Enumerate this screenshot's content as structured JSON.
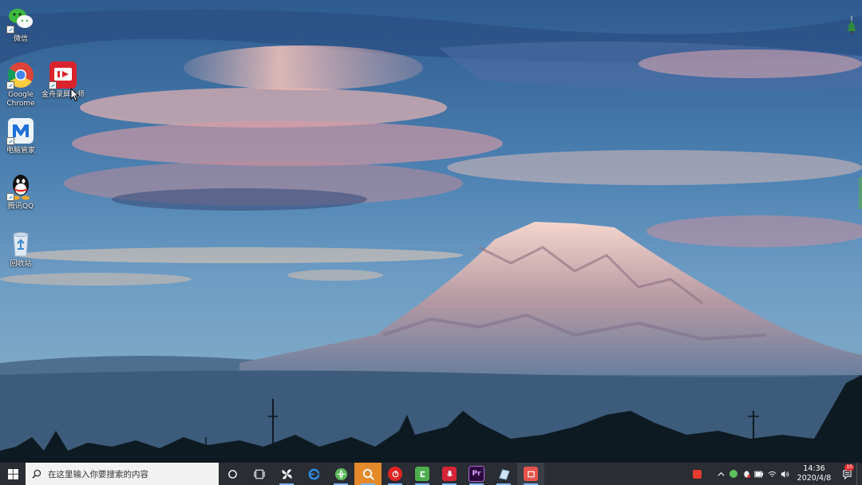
{
  "desktop": {
    "icons": [
      {
        "label": "微信",
        "icon": "wechat-icon"
      },
      {
        "label": "Google Chrome",
        "icon": "chrome-icon"
      },
      {
        "label": "金舟录屏大师",
        "icon": "screen-recorder-icon"
      },
      {
        "label": "电脑管家",
        "icon": "pc-manager-icon"
      },
      {
        "label": "腾讯QQ",
        "icon": "qq-icon"
      },
      {
        "label": "回收站",
        "icon": "recycle-bin-icon"
      }
    ]
  },
  "taskbar": {
    "search": {
      "placeholder": "在这里输入你要搜索的内容"
    },
    "apps": [
      {
        "icon": "cortana-icon"
      },
      {
        "icon": "task-view-icon"
      },
      {
        "icon": "pinwheel-app-icon"
      },
      {
        "icon": "ie-browser-icon"
      },
      {
        "icon": "green-browser-icon"
      },
      {
        "icon": "orange-app-icon",
        "active": true
      },
      {
        "icon": "netease-music-icon"
      },
      {
        "icon": "camtasia-icon"
      },
      {
        "icon": "recorder-icon"
      },
      {
        "label": "Pr",
        "icon": "premiere-icon"
      },
      {
        "icon": "notes-icon"
      },
      {
        "icon": "screen-recorder-app-icon"
      }
    ],
    "tray": {
      "icons": [
        "sogou-input-icon",
        "chevron-up-icon",
        "green-dot-icon",
        "tencent-icon",
        "battery-icon",
        "wifi-icon",
        "volume-icon"
      ],
      "time": "14:36",
      "date": "2020/4/8",
      "notification_count": "10"
    }
  },
  "colors": {
    "taskbar": "#2a2d33",
    "search_bg": "#f2f2f2",
    "active_app": "#e58a2a"
  }
}
